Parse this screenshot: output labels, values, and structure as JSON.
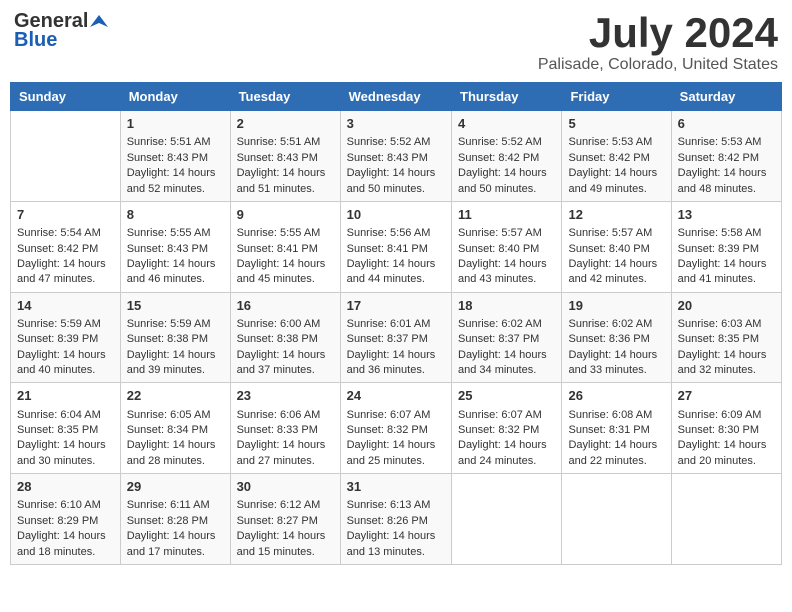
{
  "header": {
    "logo_general": "General",
    "logo_blue": "Blue",
    "month": "July 2024",
    "location": "Palisade, Colorado, United States"
  },
  "weekdays": [
    "Sunday",
    "Monday",
    "Tuesday",
    "Wednesday",
    "Thursday",
    "Friday",
    "Saturday"
  ],
  "weeks": [
    [
      {
        "day": "",
        "sunrise": "",
        "sunset": "",
        "daylight": ""
      },
      {
        "day": "1",
        "sunrise": "Sunrise: 5:51 AM",
        "sunset": "Sunset: 8:43 PM",
        "daylight": "Daylight: 14 hours and 52 minutes."
      },
      {
        "day": "2",
        "sunrise": "Sunrise: 5:51 AM",
        "sunset": "Sunset: 8:43 PM",
        "daylight": "Daylight: 14 hours and 51 minutes."
      },
      {
        "day": "3",
        "sunrise": "Sunrise: 5:52 AM",
        "sunset": "Sunset: 8:43 PM",
        "daylight": "Daylight: 14 hours and 50 minutes."
      },
      {
        "day": "4",
        "sunrise": "Sunrise: 5:52 AM",
        "sunset": "Sunset: 8:42 PM",
        "daylight": "Daylight: 14 hours and 50 minutes."
      },
      {
        "day": "5",
        "sunrise": "Sunrise: 5:53 AM",
        "sunset": "Sunset: 8:42 PM",
        "daylight": "Daylight: 14 hours and 49 minutes."
      },
      {
        "day": "6",
        "sunrise": "Sunrise: 5:53 AM",
        "sunset": "Sunset: 8:42 PM",
        "daylight": "Daylight: 14 hours and 48 minutes."
      }
    ],
    [
      {
        "day": "7",
        "sunrise": "Sunrise: 5:54 AM",
        "sunset": "Sunset: 8:42 PM",
        "daylight": "Daylight: 14 hours and 47 minutes."
      },
      {
        "day": "8",
        "sunrise": "Sunrise: 5:55 AM",
        "sunset": "Sunset: 8:43 PM",
        "daylight": "Daylight: 14 hours and 46 minutes."
      },
      {
        "day": "9",
        "sunrise": "Sunrise: 5:55 AM",
        "sunset": "Sunset: 8:41 PM",
        "daylight": "Daylight: 14 hours and 45 minutes."
      },
      {
        "day": "10",
        "sunrise": "Sunrise: 5:56 AM",
        "sunset": "Sunset: 8:41 PM",
        "daylight": "Daylight: 14 hours and 44 minutes."
      },
      {
        "day": "11",
        "sunrise": "Sunrise: 5:57 AM",
        "sunset": "Sunset: 8:40 PM",
        "daylight": "Daylight: 14 hours and 43 minutes."
      },
      {
        "day": "12",
        "sunrise": "Sunrise: 5:57 AM",
        "sunset": "Sunset: 8:40 PM",
        "daylight": "Daylight: 14 hours and 42 minutes."
      },
      {
        "day": "13",
        "sunrise": "Sunrise: 5:58 AM",
        "sunset": "Sunset: 8:39 PM",
        "daylight": "Daylight: 14 hours and 41 minutes."
      }
    ],
    [
      {
        "day": "14",
        "sunrise": "Sunrise: 5:59 AM",
        "sunset": "Sunset: 8:39 PM",
        "daylight": "Daylight: 14 hours and 40 minutes."
      },
      {
        "day": "15",
        "sunrise": "Sunrise: 5:59 AM",
        "sunset": "Sunset: 8:38 PM",
        "daylight": "Daylight: 14 hours and 39 minutes."
      },
      {
        "day": "16",
        "sunrise": "Sunrise: 6:00 AM",
        "sunset": "Sunset: 8:38 PM",
        "daylight": "Daylight: 14 hours and 37 minutes."
      },
      {
        "day": "17",
        "sunrise": "Sunrise: 6:01 AM",
        "sunset": "Sunset: 8:37 PM",
        "daylight": "Daylight: 14 hours and 36 minutes."
      },
      {
        "day": "18",
        "sunrise": "Sunrise: 6:02 AM",
        "sunset": "Sunset: 8:37 PM",
        "daylight": "Daylight: 14 hours and 34 minutes."
      },
      {
        "day": "19",
        "sunrise": "Sunrise: 6:02 AM",
        "sunset": "Sunset: 8:36 PM",
        "daylight": "Daylight: 14 hours and 33 minutes."
      },
      {
        "day": "20",
        "sunrise": "Sunrise: 6:03 AM",
        "sunset": "Sunset: 8:35 PM",
        "daylight": "Daylight: 14 hours and 32 minutes."
      }
    ],
    [
      {
        "day": "21",
        "sunrise": "Sunrise: 6:04 AM",
        "sunset": "Sunset: 8:35 PM",
        "daylight": "Daylight: 14 hours and 30 minutes."
      },
      {
        "day": "22",
        "sunrise": "Sunrise: 6:05 AM",
        "sunset": "Sunset: 8:34 PM",
        "daylight": "Daylight: 14 hours and 28 minutes."
      },
      {
        "day": "23",
        "sunrise": "Sunrise: 6:06 AM",
        "sunset": "Sunset: 8:33 PM",
        "daylight": "Daylight: 14 hours and 27 minutes."
      },
      {
        "day": "24",
        "sunrise": "Sunrise: 6:07 AM",
        "sunset": "Sunset: 8:32 PM",
        "daylight": "Daylight: 14 hours and 25 minutes."
      },
      {
        "day": "25",
        "sunrise": "Sunrise: 6:07 AM",
        "sunset": "Sunset: 8:32 PM",
        "daylight": "Daylight: 14 hours and 24 minutes."
      },
      {
        "day": "26",
        "sunrise": "Sunrise: 6:08 AM",
        "sunset": "Sunset: 8:31 PM",
        "daylight": "Daylight: 14 hours and 22 minutes."
      },
      {
        "day": "27",
        "sunrise": "Sunrise: 6:09 AM",
        "sunset": "Sunset: 8:30 PM",
        "daylight": "Daylight: 14 hours and 20 minutes."
      }
    ],
    [
      {
        "day": "28",
        "sunrise": "Sunrise: 6:10 AM",
        "sunset": "Sunset: 8:29 PM",
        "daylight": "Daylight: 14 hours and 18 minutes."
      },
      {
        "day": "29",
        "sunrise": "Sunrise: 6:11 AM",
        "sunset": "Sunset: 8:28 PM",
        "daylight": "Daylight: 14 hours and 17 minutes."
      },
      {
        "day": "30",
        "sunrise": "Sunrise: 6:12 AM",
        "sunset": "Sunset: 8:27 PM",
        "daylight": "Daylight: 14 hours and 15 minutes."
      },
      {
        "day": "31",
        "sunrise": "Sunrise: 6:13 AM",
        "sunset": "Sunset: 8:26 PM",
        "daylight": "Daylight: 14 hours and 13 minutes."
      },
      {
        "day": "",
        "sunrise": "",
        "sunset": "",
        "daylight": ""
      },
      {
        "day": "",
        "sunrise": "",
        "sunset": "",
        "daylight": ""
      },
      {
        "day": "",
        "sunrise": "",
        "sunset": "",
        "daylight": ""
      }
    ]
  ]
}
